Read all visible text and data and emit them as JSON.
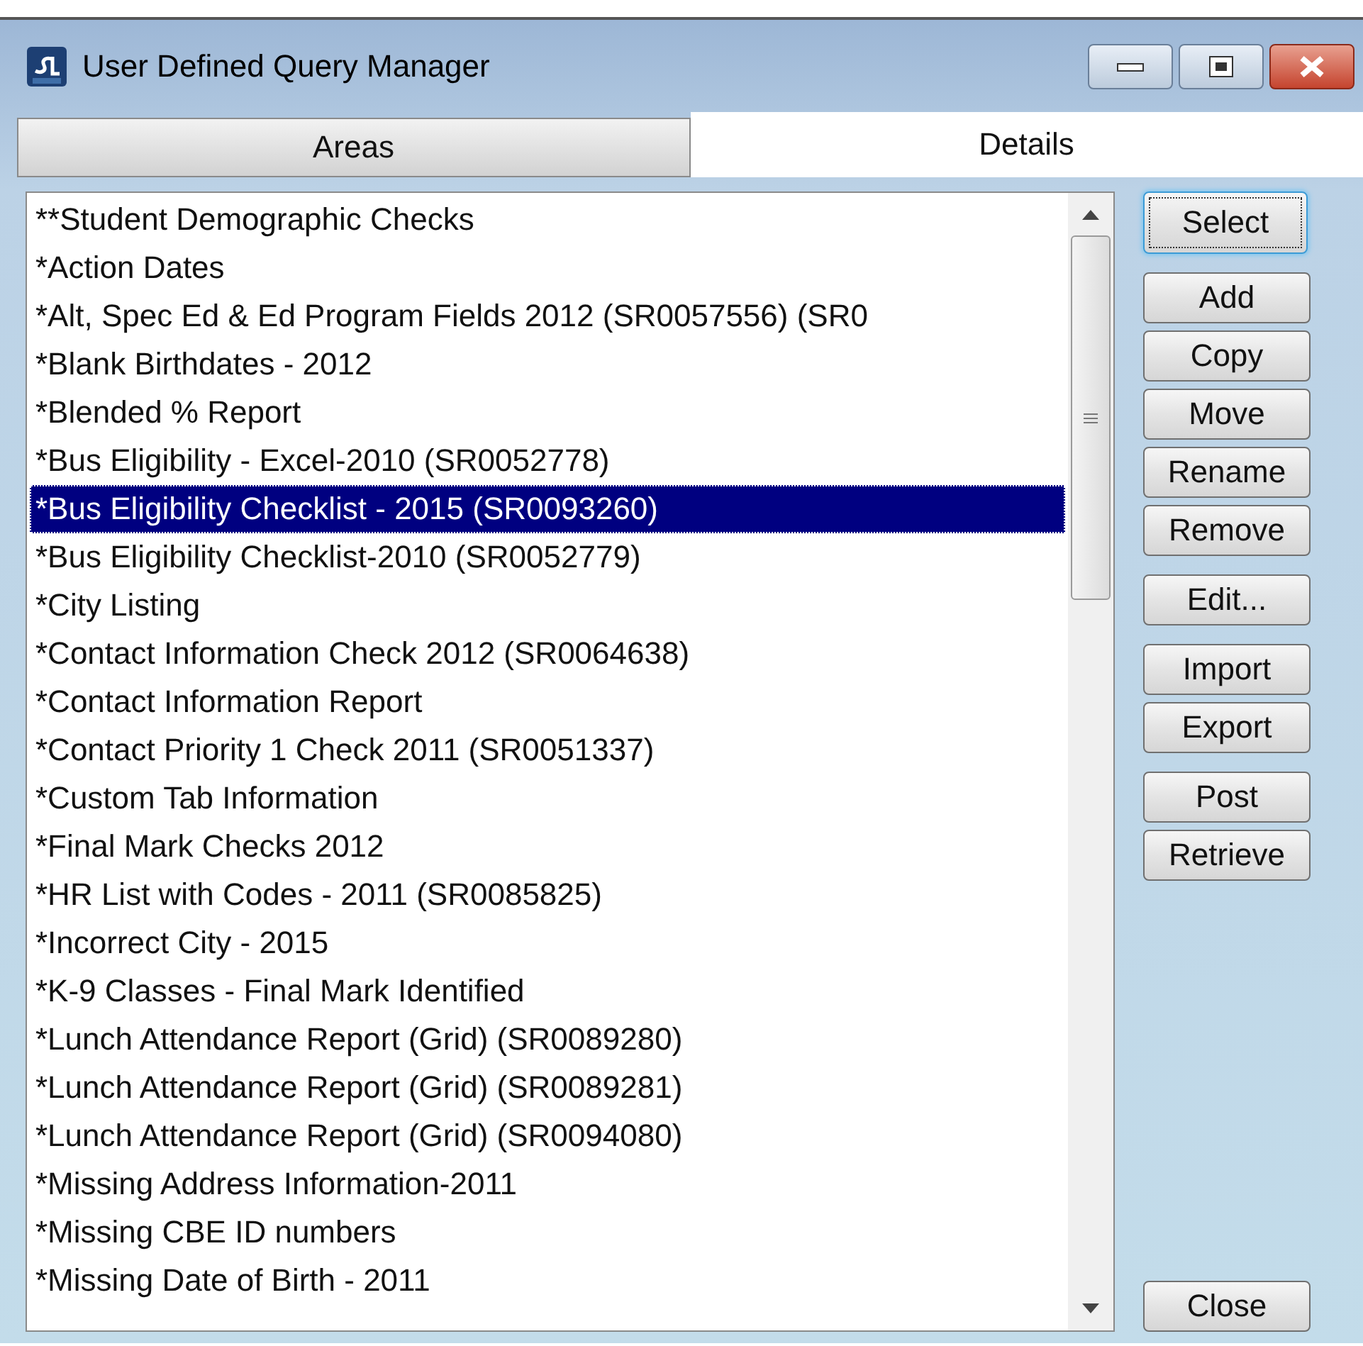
{
  "window": {
    "title": "User Defined Query Manager"
  },
  "tabs": [
    {
      "label": "Areas",
      "selected": false
    },
    {
      "label": "Details",
      "selected": true
    }
  ],
  "list": {
    "items": [
      {
        "text": "**Student Demographic Checks",
        "selected": false
      },
      {
        "text": "*Action Dates",
        "selected": false
      },
      {
        "text": "*Alt, Spec Ed & Ed Program Fields 2012 (SR0057556) (SR0",
        "selected": false
      },
      {
        "text": "*Blank Birthdates - 2012",
        "selected": false
      },
      {
        "text": "*Blended % Report",
        "selected": false
      },
      {
        "text": "*Bus Eligibility - Excel-2010 (SR0052778)",
        "selected": false
      },
      {
        "text": "*Bus Eligibility Checklist - 2015 (SR0093260)",
        "selected": true
      },
      {
        "text": "*Bus Eligibility Checklist-2010 (SR0052779)",
        "selected": false
      },
      {
        "text": "*City Listing",
        "selected": false
      },
      {
        "text": "*Contact Information Check 2012 (SR0064638)",
        "selected": false
      },
      {
        "text": "*Contact Information Report",
        "selected": false
      },
      {
        "text": "*Contact Priority 1 Check 2011 (SR0051337)",
        "selected": false
      },
      {
        "text": "*Custom Tab Information",
        "selected": false
      },
      {
        "text": "*Final Mark Checks 2012",
        "selected": false
      },
      {
        "text": "*HR List with Codes - 2011 (SR0085825)",
        "selected": false
      },
      {
        "text": "*Incorrect City - 2015",
        "selected": false
      },
      {
        "text": "*K-9 Classes - Final Mark Identified",
        "selected": false
      },
      {
        "text": "*Lunch Attendance Report (Grid) (SR0089280)",
        "selected": false
      },
      {
        "text": "*Lunch Attendance Report (Grid) (SR0089281)",
        "selected": false
      },
      {
        "text": "*Lunch Attendance Report (Grid) (SR0094080)",
        "selected": false
      },
      {
        "text": "*Missing Address Information-2011",
        "selected": false
      },
      {
        "text": "*Missing CBE ID numbers",
        "selected": false
      },
      {
        "text": "*Missing Date of Birth - 2011",
        "selected": false
      }
    ]
  },
  "button_groups": [
    [
      {
        "label": "Select",
        "focused": true
      }
    ],
    [
      {
        "label": "Add",
        "focused": false
      },
      {
        "label": "Copy",
        "focused": false
      },
      {
        "label": "Move",
        "focused": false
      },
      {
        "label": "Rename",
        "focused": false
      },
      {
        "label": "Remove",
        "focused": false
      }
    ],
    [
      {
        "label": "Edit...",
        "focused": false
      }
    ],
    [
      {
        "label": "Import",
        "focused": false
      },
      {
        "label": "Export",
        "focused": false
      }
    ],
    [
      {
        "label": "Post",
        "focused": false
      },
      {
        "label": "Retrieve",
        "focused": false
      }
    ]
  ],
  "close_button": {
    "label": "Close",
    "focused": false
  }
}
